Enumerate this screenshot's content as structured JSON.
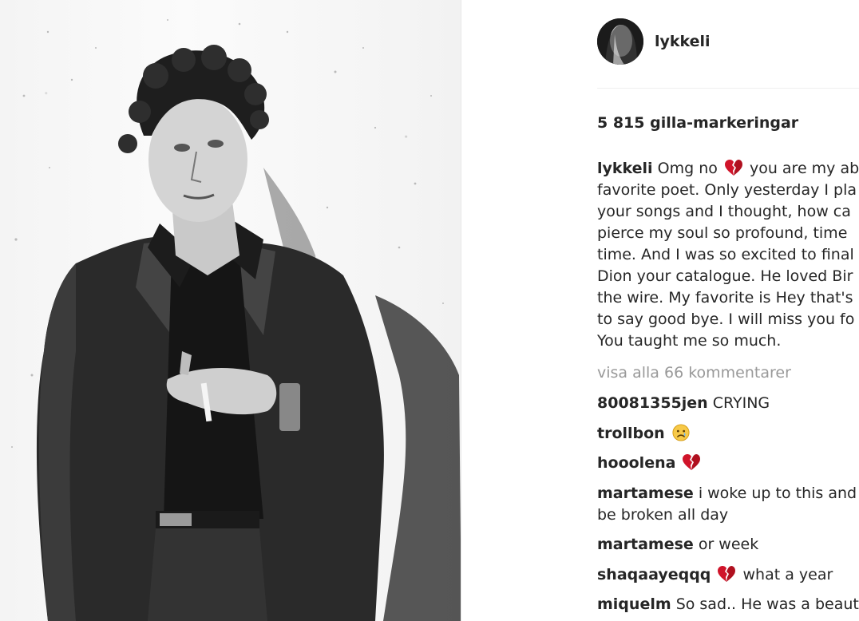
{
  "post": {
    "username": "lykkeli",
    "likes": "5 815 gilla-markeringar",
    "caption": {
      "username": "lykkeli",
      "first_line_before_emoji": "Omg no",
      "first_line_after_emoji": "you are my ab",
      "lines": [
        "favorite poet. Only yesterday I pla",
        "your songs and I thought, how ca",
        "pierce my soul so profound, time",
        "time. And I was so excited to final",
        "Dion your catalogue. He loved Bir",
        "the wire. My favorite is Hey that's",
        "to say good bye. I will miss you fo",
        "You taught me so much."
      ],
      "emoji": "broken-heart-emoji"
    },
    "view_all_comments": "visa alla 66 kommentarer"
  },
  "comments": [
    {
      "user": "80081355jen",
      "text": "CRYING"
    },
    {
      "user": "trollbon",
      "text": "",
      "emoji": "sad-face-emoji"
    },
    {
      "user": "hooolena",
      "text": "",
      "emoji": "broken-heart-emoji"
    },
    {
      "user": "martamese",
      "text": "i woke up to this and",
      "text2": "be broken all day"
    },
    {
      "user": "martamese",
      "text": "or week"
    },
    {
      "user": "shaqaayeqqq",
      "text": "what a year",
      "emoji": "broken-heart-emoji"
    },
    {
      "user": "miquelm",
      "text": "So sad.. He was a beaut"
    }
  ],
  "colors": {
    "text": "#262626",
    "muted": "#999999",
    "divider": "#efefef",
    "heart_red": "#d0142a"
  }
}
